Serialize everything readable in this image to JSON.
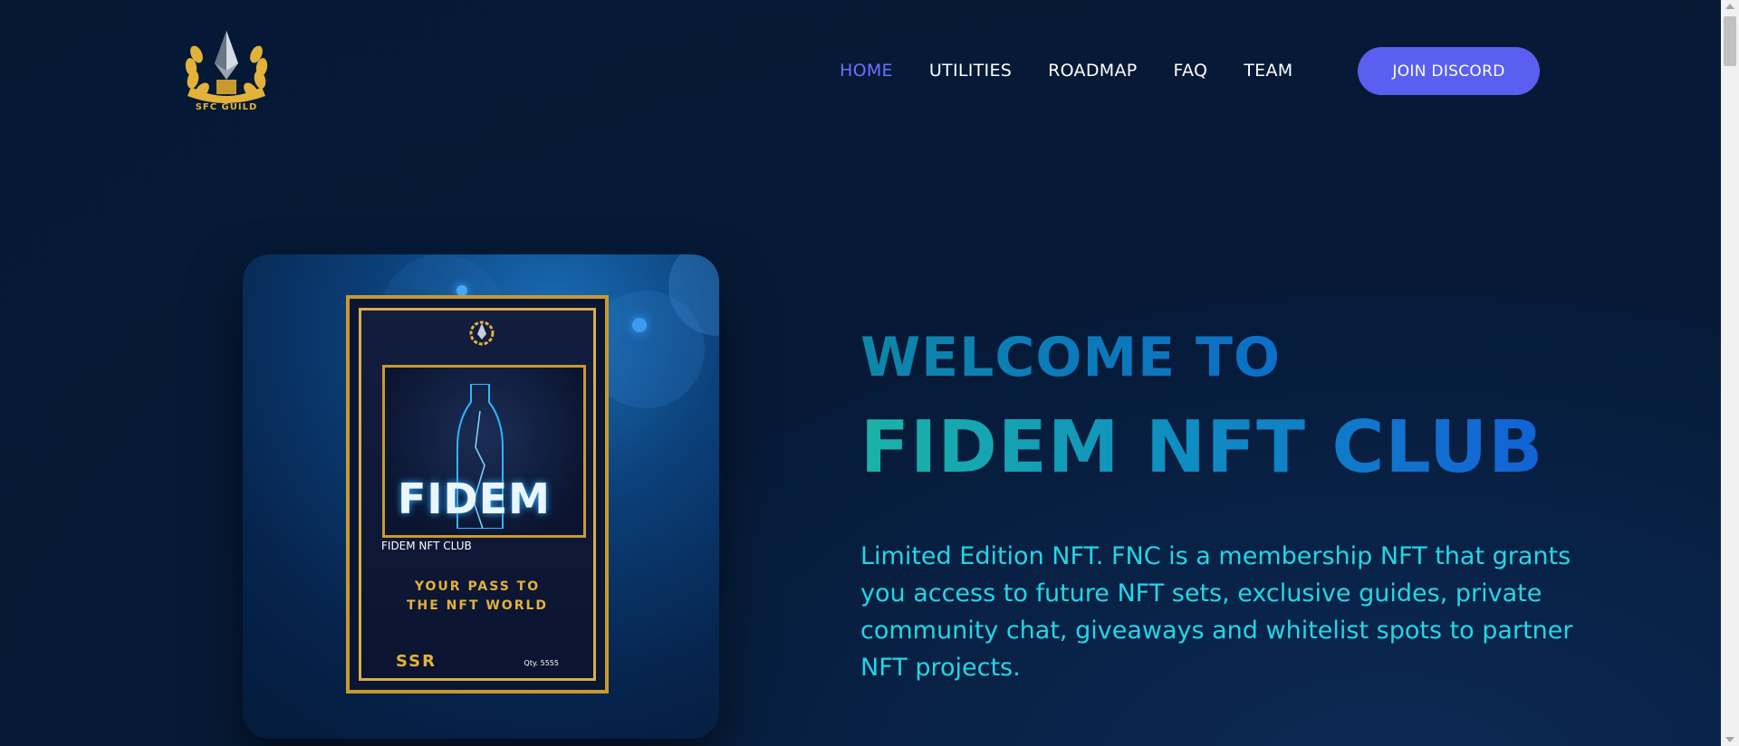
{
  "brand": {
    "logo_text": "SFC GUILD",
    "gold_color": "#e2b23a"
  },
  "nav": {
    "items": [
      {
        "label": "HOME",
        "active": true
      },
      {
        "label": "UTILITIES",
        "active": false
      },
      {
        "label": "ROADMAP",
        "active": false
      },
      {
        "label": "FAQ",
        "active": false
      },
      {
        "label": "TEAM",
        "active": false
      }
    ],
    "active_color": "#6b72ff",
    "cta_label": "JOIN DISCORD",
    "cta_color": "#5a5ff0"
  },
  "hero": {
    "nft_card": {
      "title": "FIDEM",
      "subtitle": "FIDEM NFT CLUB",
      "pass_line1": "YOUR PASS TO",
      "pass_line2": "THE NFT WORLD",
      "rarity": "SSR",
      "quantity": "Qty. 5555"
    },
    "welcome": "WELCOME TO",
    "club_name": "FIDEM NFT CLUB",
    "description": "Limited Edition NFT. FNC is a membership NFT that grants you access to future NFT sets, exclusive guides, private community chat, giveaways and whitelist spots to partner NFT projects.",
    "description_color": "#23d6e6"
  },
  "background_color": "#061a38"
}
